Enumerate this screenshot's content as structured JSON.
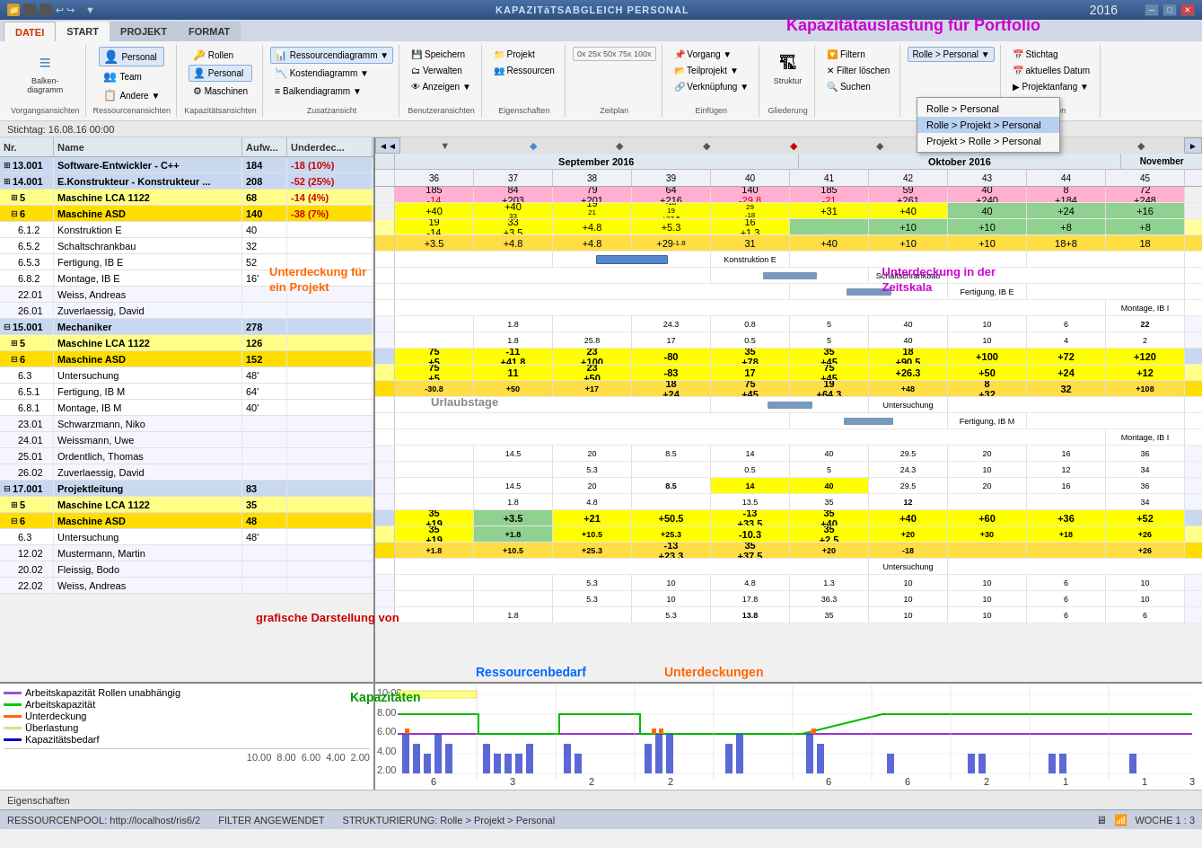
{
  "titlebar": {
    "title": "KAPAZITäTSABGLEICH PERSONAL",
    "year": "2016",
    "portfolio_title": "Kapazitätauslastung für Portfolio"
  },
  "ribbon": {
    "tabs": [
      "DATEI",
      "START",
      "PROJEKT",
      "FORMAT"
    ],
    "active_tab": "START",
    "groups": {
      "vorgangsansichten": {
        "label": "Vorgangsansichten",
        "buttons": [
          "Balkendiagramm"
        ]
      },
      "ressourcenansichten": {
        "label": "Ressourcenansichten",
        "buttons": [
          "Personal",
          "Team",
          "Andere ▼"
        ]
      },
      "kapazitaetsansichten": {
        "label": "Kapazitätsansichten",
        "buttons": [
          "Rollen",
          "Personal",
          "Maschinen"
        ]
      },
      "zusatzansicht": {
        "label": "Zusatzansicht",
        "buttons": [
          "Ressourcendiagramm ▼",
          "Kostendiagramm ▼",
          "Balkendiagramm ▼"
        ]
      },
      "benutzeransichten": {
        "label": "Benutzeransichten",
        "buttons": [
          "Speichern",
          "Verwalten",
          "Anzeigen ▼"
        ]
      },
      "eigenschaften": {
        "label": "Eigenschaften",
        "buttons": [
          "Projekt",
          "Ressourcen"
        ]
      },
      "zeitplan": {
        "label": "Zeitplan",
        "buttons": [
          "0x 25x 50x 75x 100x"
        ]
      },
      "einfuegen": {
        "label": "Einfügen",
        "buttons": [
          "Vorgang ▼",
          "Teilprojekt ▼",
          "Verknüpfung ▼"
        ]
      },
      "gliederung": {
        "label": "Gliederung",
        "buttons": [
          "Struktur"
        ]
      },
      "filter": {
        "label": "",
        "buttons": [
          "Filtern",
          "Filter löschen",
          "Suchen"
        ]
      },
      "rolle": {
        "label": "Rolle > Personal",
        "buttons": [
          "Rolle > Personal",
          "Rolle > Projekt > Personal",
          "Projekt > Rolle > Personal"
        ]
      },
      "scrollen": {
        "label": "Scrollen",
        "buttons": [
          "Stichtag",
          "aktuelles Datum",
          "Projektanfang ▼"
        ]
      }
    }
  },
  "stichtag": "Stichtag: 16.08.16 00:00",
  "nav": {
    "back": "<<",
    "forward": ">>"
  },
  "table": {
    "headers": [
      "Nr.",
      "Name",
      "Aufw...",
      "Underdec..."
    ],
    "rows": [
      {
        "nr": "13.001",
        "name": "Software-Entwickler - C++",
        "aufw": "184",
        "unterd": "-18 (10%)",
        "type": "group1",
        "unterd_class": "negative-red"
      },
      {
        "nr": "14.001",
        "name": "E.Konstrukteur - Konstrukteur ...",
        "aufw": "208",
        "unterd": "-52 (25%)",
        "type": "group1",
        "unterd_class": "negative-red"
      },
      {
        "nr": "⊞ 5",
        "name": "Maschine LCA 1122",
        "aufw": "68",
        "unterd": "-14 (4%)",
        "type": "group2y",
        "unterd_class": "negative-red"
      },
      {
        "nr": "⊟ 6",
        "name": "Maschine ASD",
        "aufw": "140",
        "unterd": "-38 (7%)",
        "type": "group2y-sel",
        "unterd_class": "negative-red"
      },
      {
        "nr": "6.1.2",
        "name": "Konstruktion E",
        "aufw": "40",
        "unterd": "",
        "type": "sub"
      },
      {
        "nr": "6.5.2",
        "name": "Schaltschrankbau",
        "aufw": "32",
        "unterd": "",
        "type": "sub"
      },
      {
        "nr": "6.5.3",
        "name": "Fertigung, IB E",
        "aufw": "52",
        "unterd": "",
        "type": "sub"
      },
      {
        "nr": "6.8.2",
        "name": "Montage, IB E",
        "aufw": "16'",
        "unterd": "",
        "type": "sub"
      },
      {
        "nr": "22.01",
        "name": "Weiss, Andreas",
        "aufw": "",
        "unterd": "",
        "type": "person"
      },
      {
        "nr": "26.01",
        "name": "Zuverlaessig, David",
        "aufw": "",
        "unterd": "",
        "type": "person"
      },
      {
        "nr": "⊟ 15.001",
        "name": "Mechaniker",
        "aufw": "278",
        "unterd": "",
        "type": "group1"
      },
      {
        "nr": "⊞ 5",
        "name": "Maschine LCA 1122",
        "aufw": "126",
        "unterd": "",
        "type": "group2y"
      },
      {
        "nr": "⊟ 6",
        "name": "Maschine ASD",
        "aufw": "152",
        "unterd": "",
        "type": "group2y-sel"
      },
      {
        "nr": "6.3",
        "name": "Untersuchung",
        "aufw": "48'",
        "unterd": "",
        "type": "sub"
      },
      {
        "nr": "6.5.1",
        "name": "Fertigung, IB M",
        "aufw": "64'",
        "unterd": "",
        "type": "sub"
      },
      {
        "nr": "6.8.1",
        "name": "Montage, IB M",
        "aufw": "40'",
        "unterd": "",
        "type": "sub"
      },
      {
        "nr": "23.01",
        "name": "Schwarzmann, Niko",
        "aufw": "",
        "unterd": "",
        "type": "person"
      },
      {
        "nr": "24.01",
        "name": "Weissmann, Uwe",
        "aufw": "",
        "unterd": "",
        "type": "person"
      },
      {
        "nr": "25.01",
        "name": "Ordentlich, Thomas",
        "aufw": "",
        "unterd": "",
        "type": "person"
      },
      {
        "nr": "26.02",
        "name": "Zuverlaessig, David",
        "aufw": "",
        "unterd": "",
        "type": "person"
      },
      {
        "nr": "⊟ 17.001",
        "name": "Projektleitung",
        "aufw": "83",
        "unterd": "",
        "type": "group1"
      },
      {
        "nr": "⊞ 5",
        "name": "Maschine LCA 1122",
        "aufw": "35",
        "unterd": "",
        "type": "group2y"
      },
      {
        "nr": "⊟ 6",
        "name": "Maschine ASD",
        "aufw": "48",
        "unterd": "",
        "type": "group2y-sel"
      },
      {
        "nr": "6.3",
        "name": "Untersuchung",
        "aufw": "48'",
        "unterd": "",
        "type": "sub"
      },
      {
        "nr": "12.02",
        "name": "Mustermann, Martin",
        "aufw": "",
        "unterd": "",
        "type": "person"
      },
      {
        "nr": "20.02",
        "name": "Fleissig, Bodo",
        "aufw": "",
        "unterd": "",
        "type": "person"
      },
      {
        "nr": "22.02",
        "name": "Weiss, Andreas",
        "aufw": "",
        "unterd": "",
        "type": "person"
      }
    ]
  },
  "gantt": {
    "months": [
      {
        "label": "September 2016",
        "weeks": [
          "36",
          "37",
          "38",
          "39",
          "40",
          "41",
          "42"
        ]
      },
      {
        "label": "Oktober 2016",
        "weeks": [
          "40",
          "41",
          "42",
          "43",
          "44",
          "45"
        ]
      },
      {
        "label": "November",
        "weeks": [
          "45"
        ]
      }
    ],
    "weeks": [
      "36",
      "37",
      "38",
      "39",
      "40",
      "41",
      "42",
      "43",
      "44",
      "45"
    ]
  },
  "annotations": {
    "unterdeckung_projekt": "Unterdeckung für\nein Projekt",
    "unterdeckung_zeitskala": "Unterdeckung in der\nZeitskala",
    "urlaubstage": "Urlaubstage",
    "ressourcenbedarf": "Ressourcenbedarf",
    "unterdeckungen": "Unterdeckungen",
    "kapazitaeten": "Kapazitäten",
    "grafische_darstellung": "grafische Darstellung von"
  },
  "legend": {
    "items": [
      {
        "color": "#8855cc",
        "label": "Arbeitskapazität Rollen unabhängig"
      },
      {
        "color": "#00cc00",
        "label": "Arbeitskapazität"
      },
      {
        "color": "#ff6600",
        "label": "Unterdeckung"
      },
      {
        "color": "#ffff00",
        "label": "Überlastung"
      },
      {
        "color": "#0000cc",
        "label": "Kapazitätsbedarf"
      }
    ]
  },
  "chart_y_axis": [
    "10.00",
    "8.00",
    "6.00",
    "4.00",
    "2.00"
  ],
  "statusbar": {
    "properties": "Eigenschaften",
    "ressourcenpool": "RESSOURCENPOOL: http://localhost/ris6/2",
    "filter": "FILTER ANGEWENDET",
    "strukturierung": "STRUKTURIERUNG: Rolle > Projekt > Personal",
    "woche": "WOCHE 1 : 3"
  },
  "dropdown": {
    "items": [
      "Rolle > Personal",
      "Rolle > Projekt > Personal",
      "Projekt > Rolle > Personal"
    ],
    "selected": "Rolle > Projekt > Personal"
  }
}
